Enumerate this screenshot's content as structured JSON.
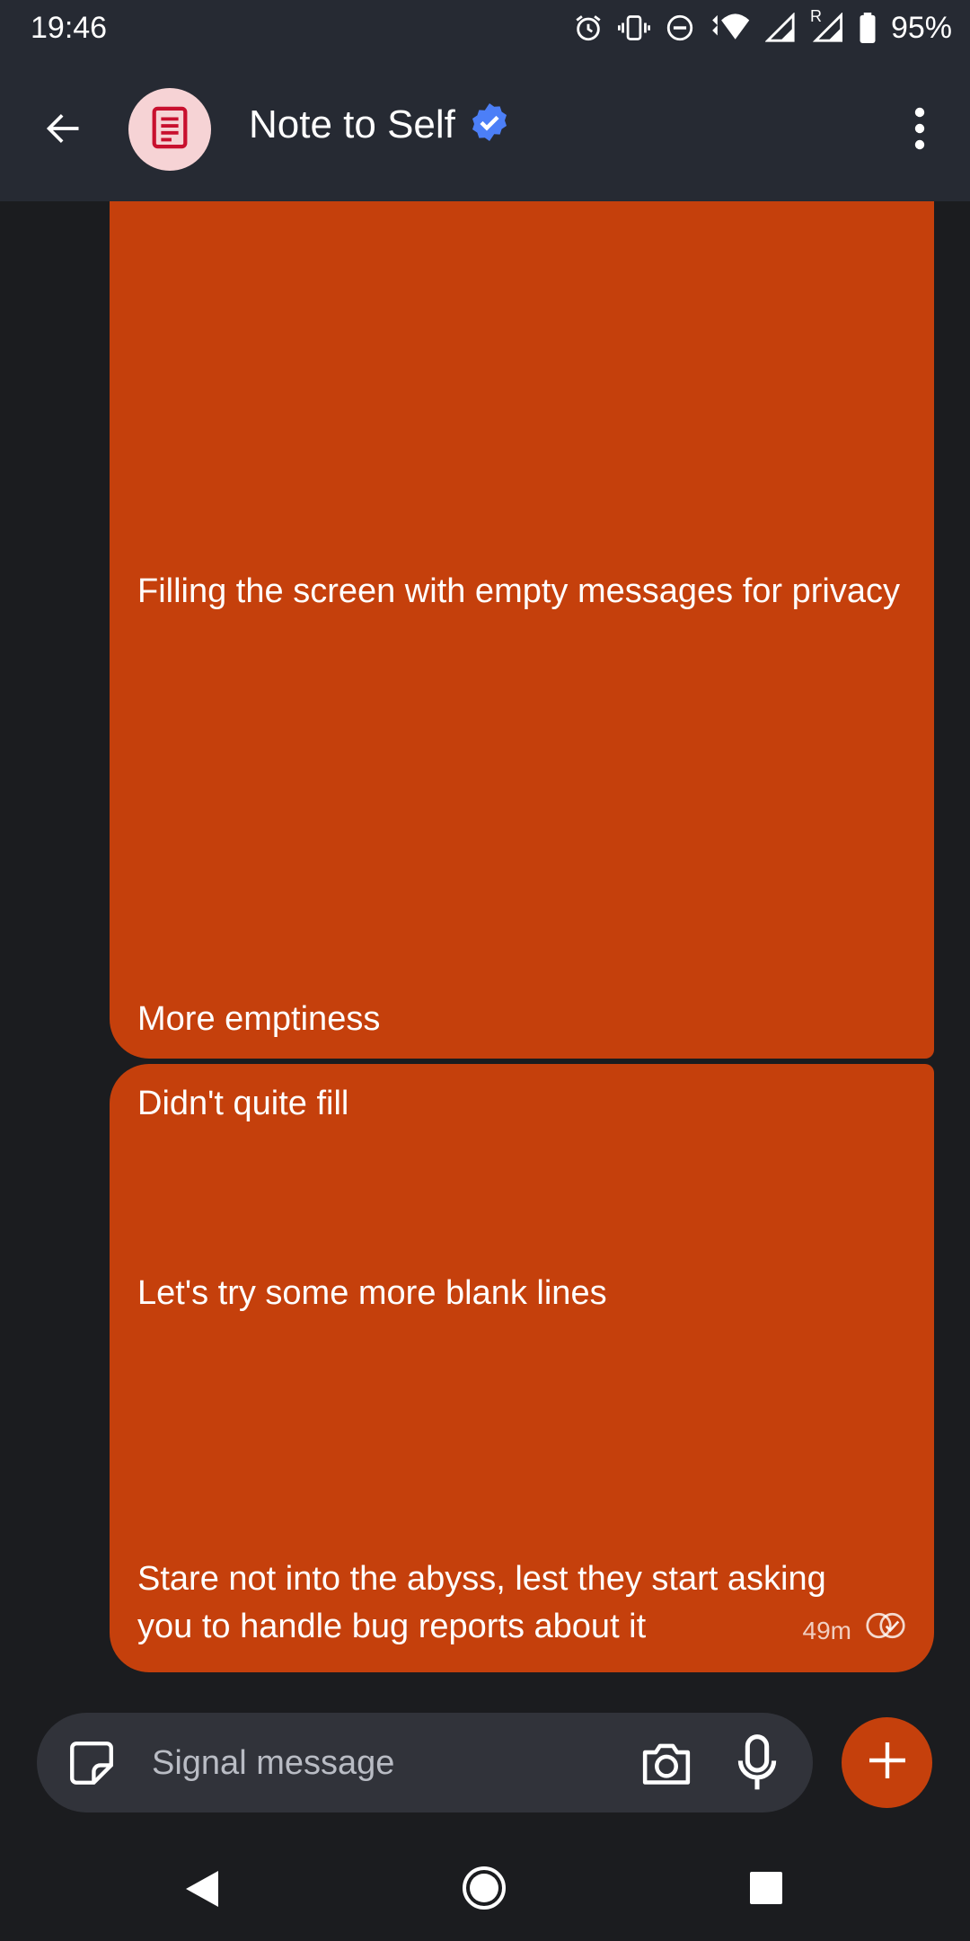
{
  "status_bar": {
    "time": "19:46",
    "battery_percent": "95%",
    "icons": [
      "alarm-icon",
      "vibrate-icon",
      "do-not-disturb-icon",
      "wifi-icon",
      "cell-signal-icon",
      "roaming-signal-icon",
      "battery-icon"
    ],
    "roaming_label": "R"
  },
  "header": {
    "title": "Note to Self",
    "verified": true,
    "avatar_icon": "note-icon",
    "back_icon": "back-arrow-icon",
    "menu_icon": "overflow-menu-icon"
  },
  "messages": [
    {
      "lines": [
        "Filling the screen with empty messages for privacy",
        "More emptiness"
      ]
    },
    {
      "lines": [
        "Didn't quite fill",
        "Let's try some more blank lines",
        "Stare not into the abyss, lest they start asking you to handle bug reports about it"
      ],
      "timestamp": "49m",
      "status_icon": "delivered-check-icon"
    }
  ],
  "composer": {
    "placeholder": "Signal message",
    "value": ""
  },
  "colors": {
    "bubble": "#c5400c",
    "app_bar": "#262a33",
    "background": "#1b1c1f",
    "composer": "#31333a",
    "avatar_bg": "#f6d3d5",
    "avatar_fg": "#c8102e",
    "verified_badge": "#4c7ff7"
  }
}
